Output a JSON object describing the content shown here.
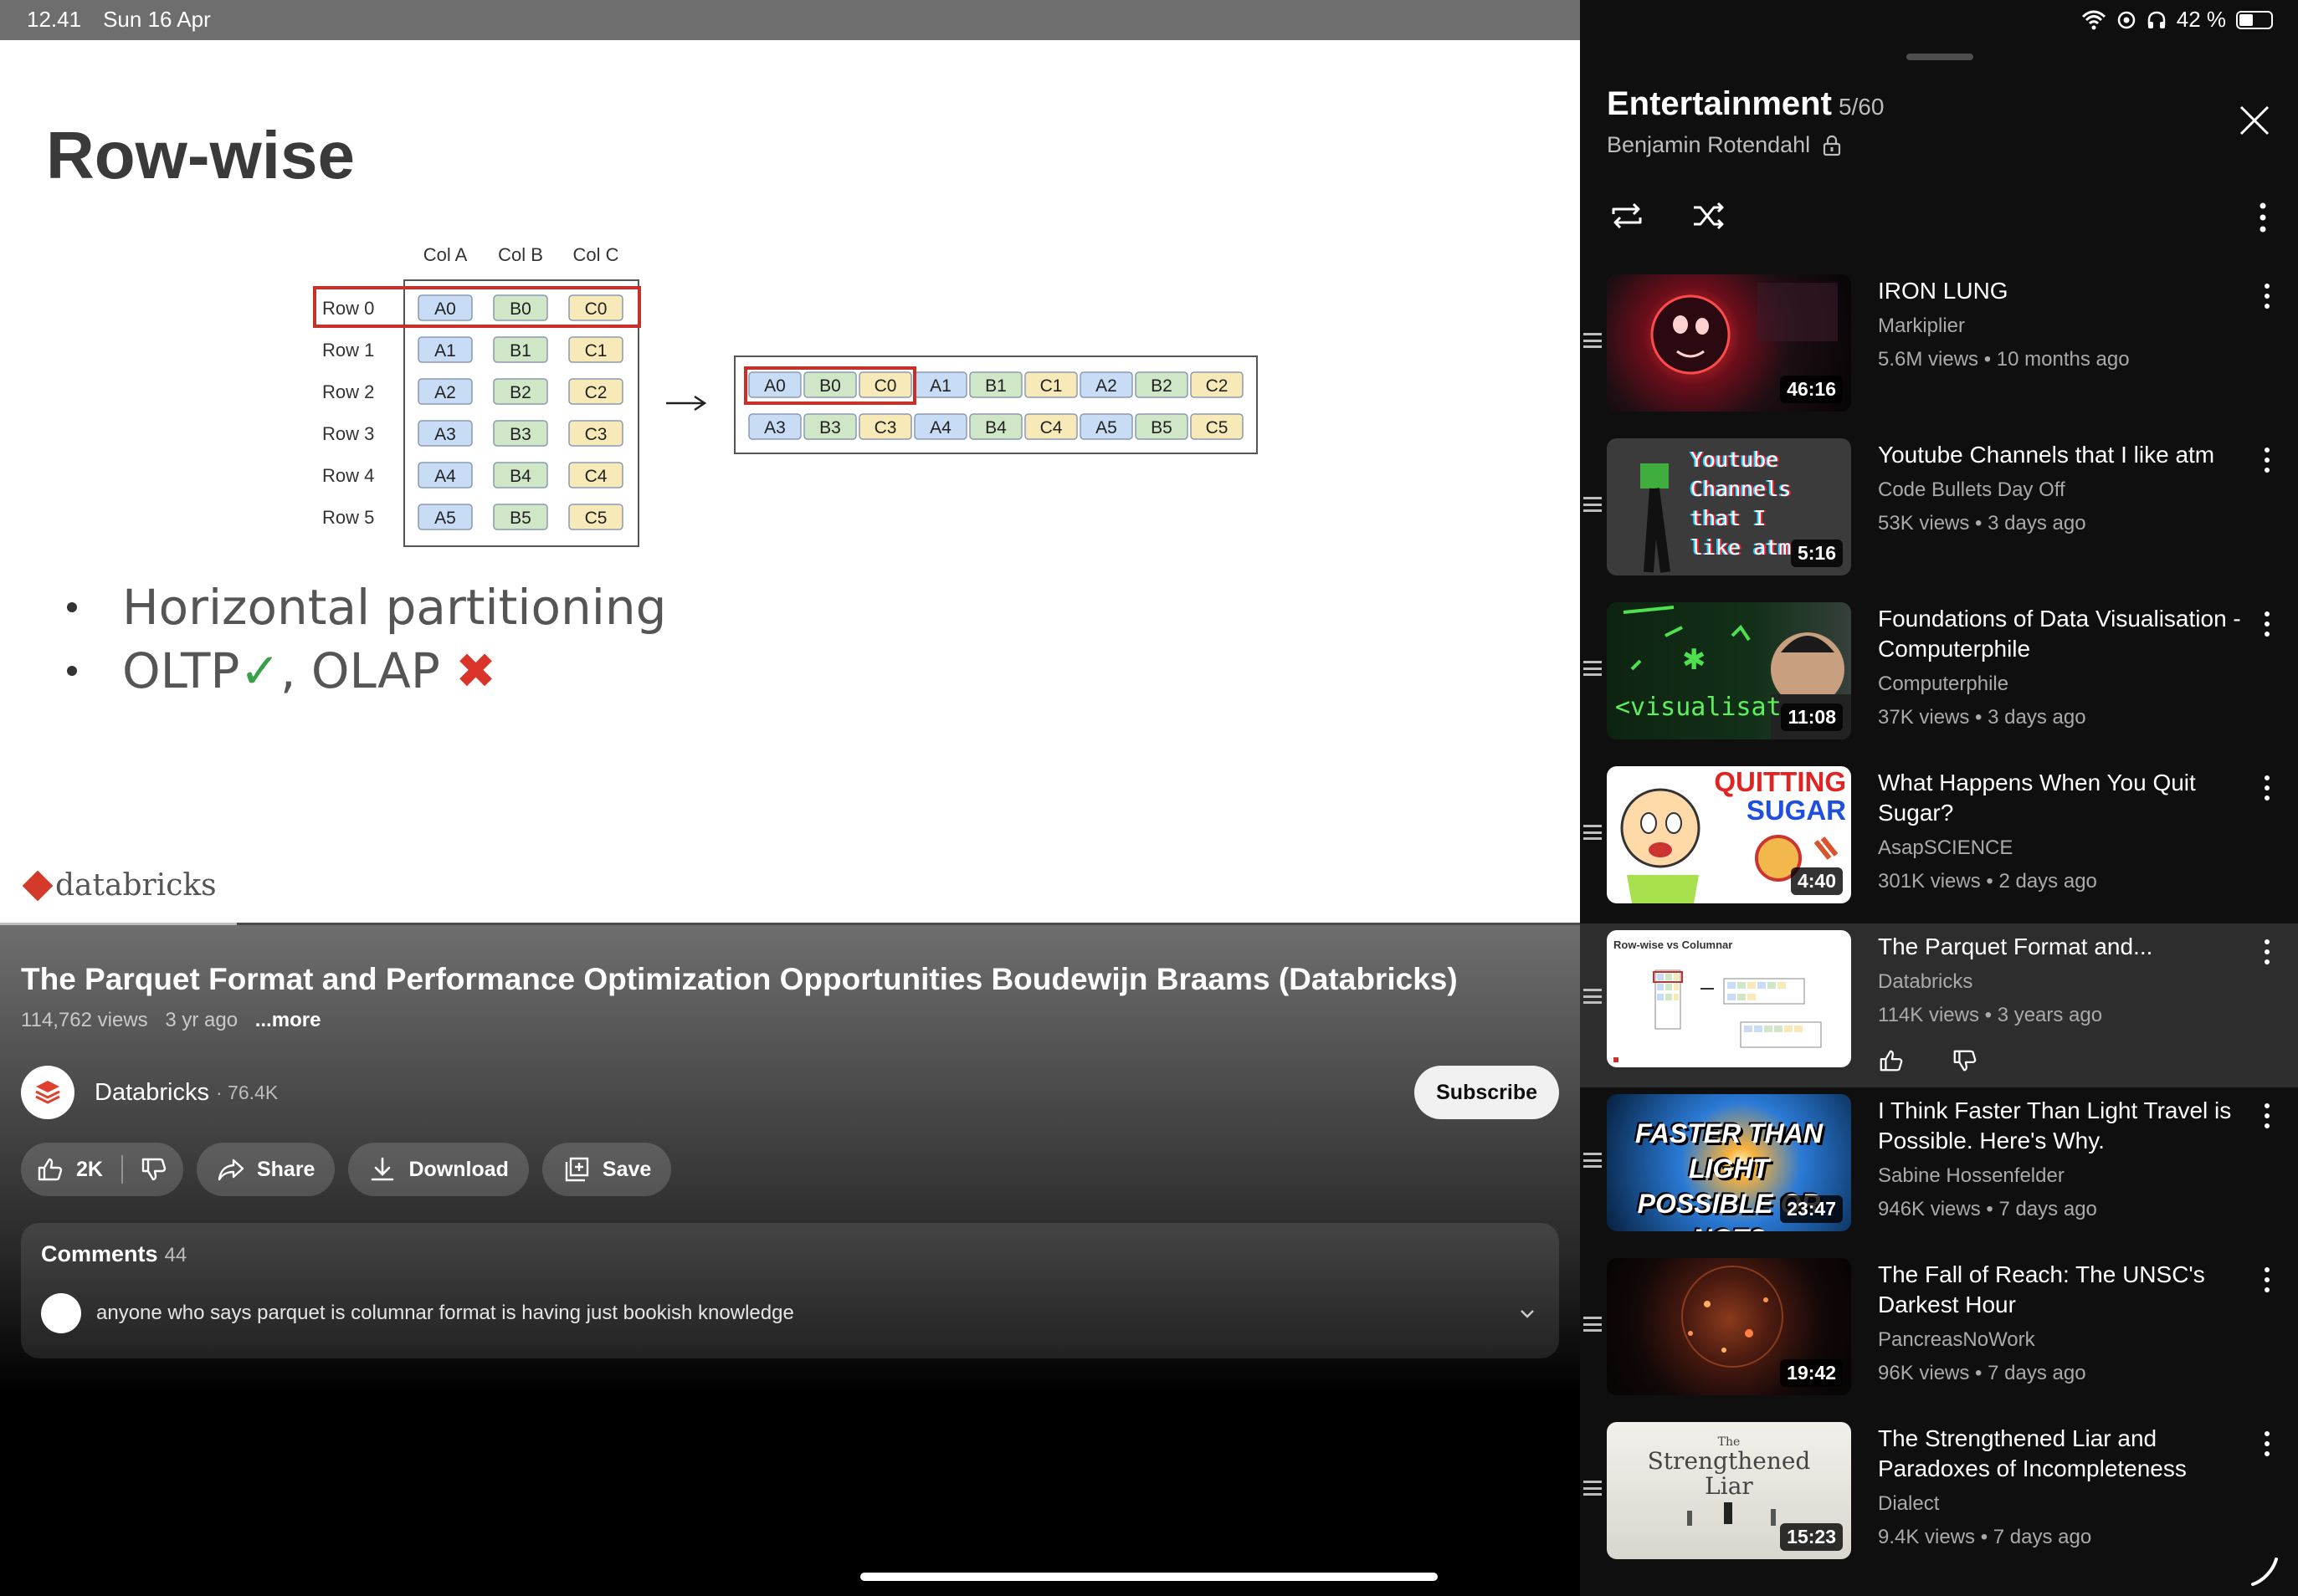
{
  "status": {
    "time": "12.41",
    "date": "Sun 16 Apr",
    "battery": "42 %"
  },
  "slide": {
    "title": "Row-wise",
    "col_headers": [
      "Col A",
      "Col B",
      "Col C"
    ],
    "row_labels": [
      "Row 0",
      "Row 1",
      "Row 2",
      "Row 3",
      "Row 4",
      "Row 5"
    ],
    "cells": [
      [
        "A0",
        "B0",
        "C0"
      ],
      [
        "A1",
        "B1",
        "C1"
      ],
      [
        "A2",
        "B2",
        "C2"
      ],
      [
        "A3",
        "B3",
        "C3"
      ],
      [
        "A4",
        "B4",
        "C4"
      ],
      [
        "A5",
        "B5",
        "C5"
      ]
    ],
    "linear_row1": [
      "A0",
      "B0",
      "C0",
      "A1",
      "B1",
      "C1",
      "A2",
      "B2",
      "C2"
    ],
    "linear_row2": [
      "A3",
      "B3",
      "C3",
      "A4",
      "B4",
      "C4",
      "A5",
      "B5",
      "C5"
    ],
    "bullets": [
      "Horizontal partitioning",
      "OLTP",
      ", OLAP "
    ],
    "check": "✓",
    "cross": "✖",
    "brand": "databricks",
    "colors": {
      "col_a": "#c9dcf5",
      "col_b": "#cfe6c7",
      "col_c": "#f8eab8",
      "highlight": "#c8312a"
    }
  },
  "video": {
    "progress_fraction": 0.15,
    "title": "The Parquet Format and Performance Optimization Opportunities Boudewijn Braams (Databricks)",
    "views": "114,762 views",
    "age": "3 yr ago",
    "more": "...more",
    "channel": "Databricks",
    "subscribers": "· 76.4K",
    "subscribe": "Subscribe",
    "likes": "2K",
    "share": "Share",
    "download": "Download",
    "save": "Save",
    "comments_label": "Comments",
    "comments_count": "44",
    "top_comment": "anyone who says parquet is columnar format is having just bookish knowledge"
  },
  "playlist": {
    "title": "Entertainment",
    "position": "5/60",
    "owner": "Benjamin Rotendahl",
    "items": [
      {
        "title": "IRON LUNG",
        "channel": "Markiplier",
        "stats": "5.6M views • 10 months ago",
        "duration": "46:16",
        "thumb": "iron-lung"
      },
      {
        "title": "Youtube Channels that I like atm",
        "channel": "Code Bullets Day Off",
        "stats": "53K views • 3 days ago",
        "duration": "5:16",
        "thumb": "code-bullet",
        "thumb_text": [
          "Youtube",
          "Channels",
          "that I",
          "like atm"
        ]
      },
      {
        "title": "Foundations of Data Visualisation - Computerphile",
        "channel": "Computerphile",
        "stats": "37K views • 3 days ago",
        "duration": "11:08",
        "thumb": "computerphile",
        "thumb_text": "<visualisat"
      },
      {
        "title": "What Happens When You Quit Sugar?",
        "channel": "AsapSCIENCE",
        "stats": "301K views • 2 days ago",
        "duration": "4:40",
        "thumb": "sugar",
        "thumb_text": [
          "QUITTING",
          "SUGAR"
        ]
      },
      {
        "title": "The Parquet Format and...",
        "channel": "Databricks",
        "stats": "114K views • 3 years ago",
        "duration": "",
        "thumb": "parquet",
        "thumb_text": "Row-wise vs Columnar",
        "active": true
      },
      {
        "title": "I Think Faster Than Light Travel is Possible. Here's Why.",
        "channel": "Sabine Hossenfelder",
        "stats": "946K views • 7 days ago",
        "duration": "23:47",
        "thumb": "ftl",
        "thumb_text": [
          "FASTER THAN LIGHT",
          "POSSIBLE OR NOT?"
        ]
      },
      {
        "title": "The Fall of Reach: The UNSC's Darkest Hour",
        "channel": "PancreasNoWork",
        "stats": "96K views • 7 days ago",
        "duration": "19:42",
        "thumb": "halo"
      },
      {
        "title": "The Strengthened Liar and Paradoxes of Incompleteness",
        "channel": "Dialect",
        "stats": "9.4K views • 7 days ago",
        "duration": "15:23",
        "thumb": "liar",
        "thumb_text": [
          "The",
          "Strengthened",
          "Liar"
        ]
      }
    ]
  }
}
